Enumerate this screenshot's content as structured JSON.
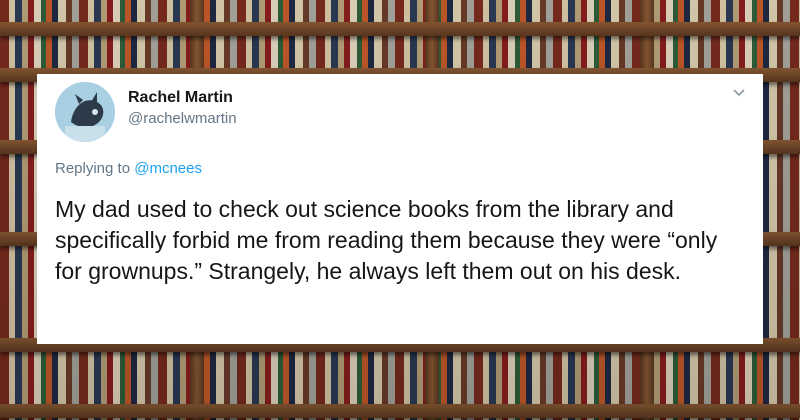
{
  "tweet": {
    "author_name": "Rachel Martin",
    "author_handle": "@rachelwmartin",
    "replying_prefix": "Replying to",
    "replying_to": "@mcnees",
    "text": "My dad used to check out science books from the library and specifically forbid me from reading them because they were “only for grownups.” Strangely, he always left them out on his desk."
  },
  "icons": {
    "avatar": "avatar-image",
    "menu": "chevron-down-icon"
  },
  "colors": {
    "card_background": "#ffffff",
    "name_text": "#14171a",
    "secondary_text": "#657786",
    "mention_link": "#1da1f2"
  }
}
